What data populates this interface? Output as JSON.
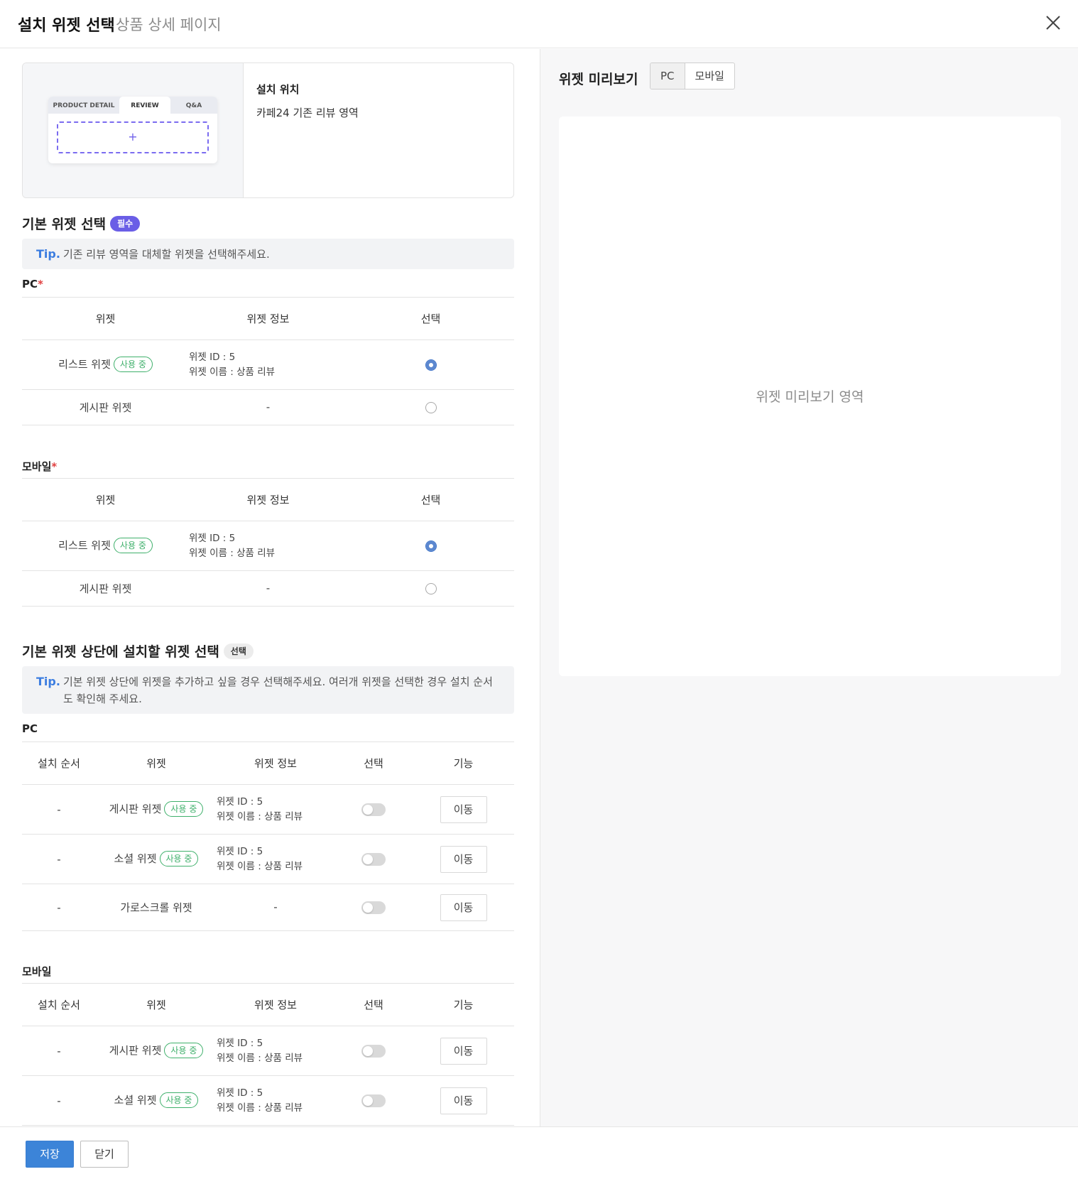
{
  "header": {
    "title": "설치 위젯 선택",
    "subtitle": "상품 상세 페이지",
    "close_icon": "close-icon"
  },
  "location": {
    "illustration_tabs": [
      "PRODUCT DETAIL",
      "REVIEW",
      "Q&A"
    ],
    "illustration_plus": "+",
    "label": "설치 위치",
    "value": "카페24 기존 리뷰 영역"
  },
  "basic_section": {
    "title": "기본 위젯 선택",
    "badge": "필수",
    "tip_label": "Tip.",
    "tip_text": "기존 리뷰 영역을 대체할 위젯을 선택해주세요.",
    "headers": [
      "위젯",
      "위젯 정보",
      "선택"
    ],
    "pc": {
      "label": "PC",
      "required_mark": "*",
      "rows": [
        {
          "widget": "리스트 위젯",
          "badge": "사용 중",
          "info_id": "위젯 ID : 5",
          "info_name": "위젯 이름 : 상품 리뷰",
          "selected": true
        },
        {
          "widget": "게시판 위젯",
          "badge": "",
          "info_dash": "-",
          "selected": false
        }
      ]
    },
    "mobile": {
      "label": "모바일",
      "required_mark": "*",
      "rows": [
        {
          "widget": "리스트 위젯",
          "badge": "사용 중",
          "info_id": "위젯 ID : 5",
          "info_name": "위젯 이름 : 상품 리뷰",
          "selected": true
        },
        {
          "widget": "게시판 위젯",
          "badge": "",
          "info_dash": "-",
          "selected": false
        }
      ]
    }
  },
  "top_section": {
    "title": "기본 위젯 상단에 설치할 위젯 선택",
    "badge": "선택",
    "tip_label": "Tip.",
    "tip_text": "기본 위젯 상단에 위젯을 추가하고 싶을 경우 선택해주세요. 여러개 위젯을 선택한 경우 설치 순서도 확인해 주세요.",
    "headers": [
      "설치 순서",
      "위젯",
      "위젯 정보",
      "선택",
      "기능"
    ],
    "move_label": "이동",
    "pc": {
      "label": "PC",
      "rows": [
        {
          "order": "-",
          "widget": "게시판 위젯",
          "badge": "사용 중",
          "info_id": "위젯 ID : 5",
          "info_name": "위젯 이름 : 상품 리뷰",
          "on": false
        },
        {
          "order": "-",
          "widget": "소셜 위젯",
          "badge": "사용 중",
          "info_id": "위젯 ID : 5",
          "info_name": "위젯 이름 : 상품 리뷰",
          "on": false
        },
        {
          "order": "-",
          "widget": "가로스크롤 위젯",
          "badge": "",
          "info_dash": "-",
          "on": false
        }
      ]
    },
    "mobile": {
      "label": "모바일",
      "rows": [
        {
          "order": "-",
          "widget": "게시판 위젯",
          "badge": "사용 중",
          "info_id": "위젯 ID : 5",
          "info_name": "위젯 이름 : 상품 리뷰",
          "on": false
        },
        {
          "order": "-",
          "widget": "소셜 위젯",
          "badge": "사용 중",
          "info_id": "위젯 ID : 5",
          "info_name": "위젯 이름 : 상품 리뷰",
          "on": false
        }
      ]
    }
  },
  "preview": {
    "title": "위젯 미리보기",
    "tabs": [
      "PC",
      "모바일"
    ],
    "active_tab": "PC",
    "placeholder": "위젯 미리보기 영역"
  },
  "footer": {
    "save_label": "저장",
    "close_label": "닫기"
  },
  "colors": {
    "accent_blue": "#3c84d8",
    "required_purple": "#6a5ee6",
    "in_use_green": "#3fb06b",
    "tip_blue": "#3c7de0",
    "required_red": "#e04040"
  }
}
